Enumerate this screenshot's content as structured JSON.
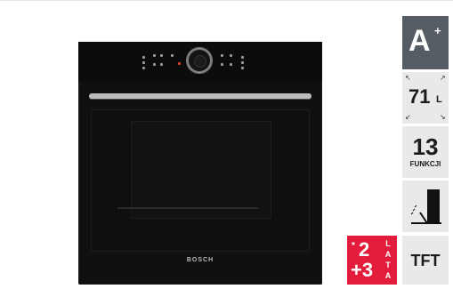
{
  "oven": {
    "brand": "BOSCH"
  },
  "badges": {
    "energy": {
      "class": "A",
      "plus": "+"
    },
    "volume": {
      "value": "71",
      "unit": "L"
    },
    "functions": {
      "count": "13",
      "label": "FUNKCJI"
    },
    "display": {
      "label": "TFT"
    },
    "warranty": {
      "star": "*",
      "base": "2",
      "extra": "+3",
      "lata_letters": [
        "L",
        "A",
        "T",
        "A"
      ]
    }
  },
  "colors": {
    "energy_bg": "#555c63",
    "tile_bg": "#e8e9e9",
    "warranty_bg": "#e21c3a",
    "oven_body": "#101010"
  }
}
